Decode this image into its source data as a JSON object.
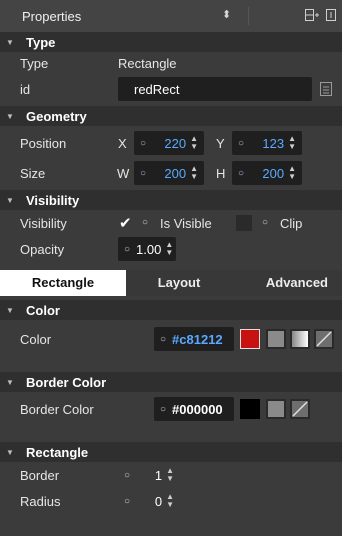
{
  "header": {
    "title": "Properties",
    "sort_icon": "↕",
    "split_icon": "split-add-icon",
    "close_icon": "close-panel-icon"
  },
  "type_section": {
    "title": "Type",
    "type_label": "Type",
    "type_value": "Rectangle",
    "id_label": "id",
    "id_value": "redRect"
  },
  "geometry": {
    "title": "Geometry",
    "position_label": "Position",
    "x_label": "X",
    "x_value": "220",
    "y_label": "Y",
    "y_value": "123",
    "size_label": "Size",
    "w_label": "W",
    "w_value": "200",
    "h_label": "H",
    "h_value": "200"
  },
  "visibility": {
    "title": "Visibility",
    "visibility_label": "Visibility",
    "is_visible_label": "Is Visible",
    "is_visible_checked": true,
    "clip_label": "Clip",
    "clip_checked": false,
    "opacity_label": "Opacity",
    "opacity_value": "1.00"
  },
  "tabs": [
    {
      "label": "Rectangle",
      "active": true
    },
    {
      "label": "Layout",
      "active": false
    },
    {
      "label": "Advanced",
      "active": false
    }
  ],
  "color_section": {
    "title": "Color",
    "color_label": "Color",
    "color_value": "#c81212",
    "swatch": "#c81212"
  },
  "border_color_section": {
    "title": "Border Color",
    "label": "Border Color",
    "value": "#000000",
    "swatch": "#000000"
  },
  "rectangle_section": {
    "title": "Rectangle",
    "border_label": "Border",
    "border_value": "1",
    "radius_label": "Radius",
    "radius_value": "0"
  },
  "colors": {
    "panel_bg": "#3b3b3b",
    "section_bg": "#2f2f2f",
    "field_bg": "#1f1f1f",
    "accent_blue": "#59a9ff"
  }
}
